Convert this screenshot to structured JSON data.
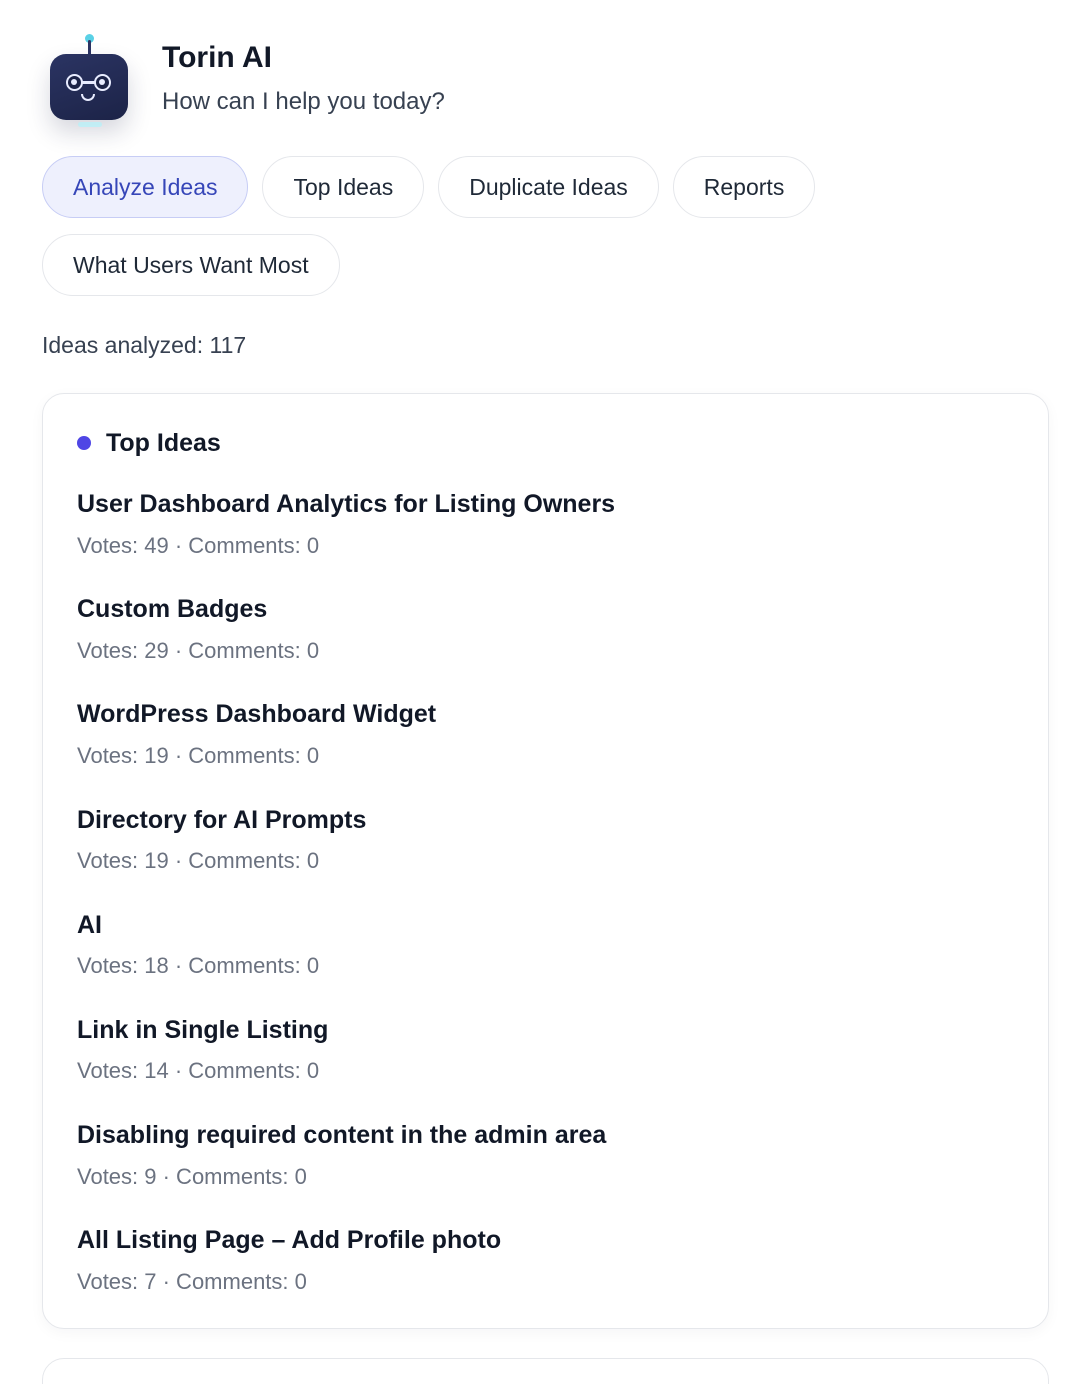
{
  "header": {
    "title": "Torin AI",
    "subtitle": "How can I help you today?",
    "avatar_icon": "robot-icon"
  },
  "chips": [
    {
      "label": "Analyze Ideas",
      "active": true
    },
    {
      "label": "Top Ideas",
      "active": false
    },
    {
      "label": "Duplicate Ideas",
      "active": false
    },
    {
      "label": "Reports",
      "active": false
    },
    {
      "label": "What Users Want Most",
      "active": false
    }
  ],
  "summary": {
    "analyzed_text": "Ideas analyzed: 117"
  },
  "card": {
    "title": "Top Ideas",
    "accent_color": "#4f46e5",
    "ideas": [
      {
        "title": "User Dashboard Analytics for Listing Owners",
        "meta": "Votes: 49 · Comments: 0"
      },
      {
        "title": "Custom Badges",
        "meta": "Votes: 29 · Comments: 0"
      },
      {
        "title": "WordPress Dashboard Widget",
        "meta": "Votes: 19 · Comments: 0"
      },
      {
        "title": "Directory for AI Prompts",
        "meta": "Votes: 19 · Comments: 0"
      },
      {
        "title": "AI",
        "meta": "Votes: 18 · Comments: 0"
      },
      {
        "title": "Link in Single Listing",
        "meta": "Votes: 14 · Comments: 0"
      },
      {
        "title": "Disabling required content in the admin area",
        "meta": "Votes: 9 · Comments: 0"
      },
      {
        "title": "All Listing Page – Add Profile photo",
        "meta": "Votes: 7 · Comments: 0"
      }
    ]
  }
}
